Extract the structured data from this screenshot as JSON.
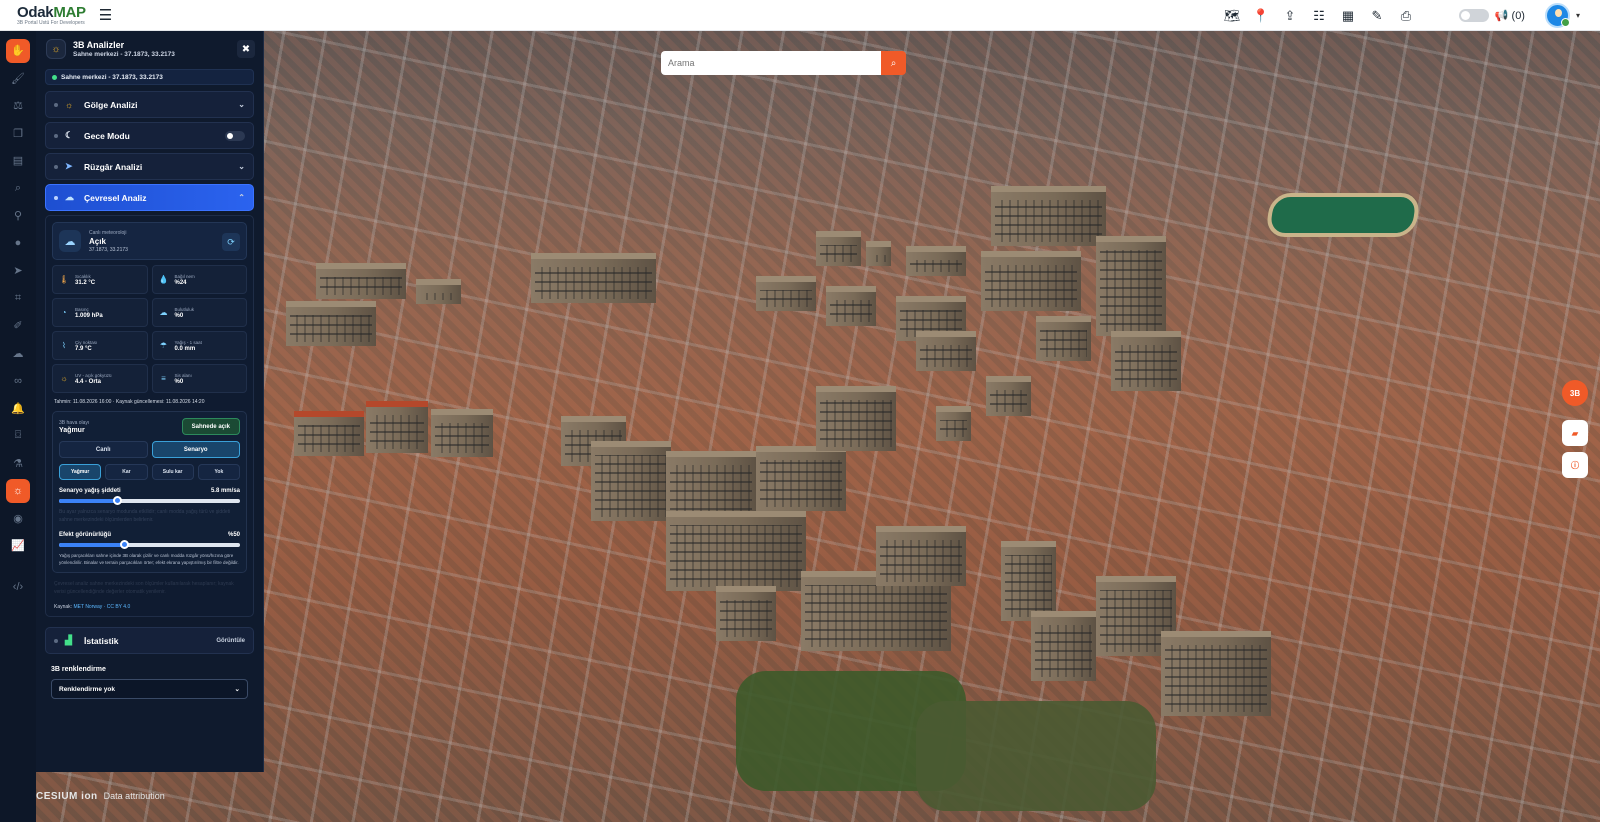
{
  "app": {
    "logo_main_a": "Odak",
    "logo_main_b": "MAP",
    "logo_sub": "3B Portal Ustü For Developers"
  },
  "header": {
    "notif_count": "(0)"
  },
  "search": {
    "placeholder": "Arama"
  },
  "map": {
    "btn_3d": "3B",
    "cesium_brand": "CESIUM ion",
    "cesium_attrib": "Data attribution"
  },
  "panel": {
    "title": "3B Analizler",
    "subtitle": "Sahne merkezi - 37.1873, 33.2173",
    "scene_strip": "Sahne merkezi - 37.1873, 33.2173",
    "sections": {
      "shadow": "Gölge Analizi",
      "night": "Gece Modu",
      "wind": "Rüzgâr Analizi",
      "env": "Çevresel Analiz",
      "stats": "İstatistik",
      "stats_side": "Görüntüle"
    },
    "current": {
      "label": "Canlı meteoroloji",
      "value": "Açık",
      "coords": "37.1873, 33.2173"
    },
    "metrics": [
      {
        "label": "Sıcaklık",
        "value": "31.2 °C",
        "icon": "thermometer-icon"
      },
      {
        "label": "Bağıl nem",
        "value": "%24",
        "icon": "droplet-icon"
      },
      {
        "label": "Basınç",
        "value": "1.009 hPa",
        "icon": "gauge-icon"
      },
      {
        "label": "Bulutluluk",
        "value": "%0",
        "icon": "cloud-icon"
      },
      {
        "label": "Çiy noktası",
        "value": "7.9 °C",
        "icon": "dew-icon"
      },
      {
        "label": "Yağış - 1 saat",
        "value": "0.0 mm",
        "icon": "umbrella-icon"
      },
      {
        "label": "UV - açık gökyüzü",
        "value": "4.4 - Orta",
        "icon": "sun-icon"
      },
      {
        "label": "Sis alanı",
        "value": "%0",
        "icon": "fog-icon"
      }
    ],
    "time_line": "Tahmin: 11.08.2026 16:00 · Kaynak güncellemesi: 11.08.2026 14:20",
    "scenario": {
      "label": "3B hava olayı",
      "value": "Yağmur",
      "open_btn": "Sahnede açık",
      "mode_live": "Canlı",
      "mode_scenario": "Senaryo",
      "types": [
        "Yağmur",
        "Kar",
        "Sulu kar",
        "Yok"
      ],
      "intensity_label": "Senaryo yağış şiddeti",
      "intensity_value": "5.8 mm/sa",
      "intensity_pct": 0.32,
      "faded_text": "Bu ayar yalnızca senaryo modunda etkilidir; canlı modda yağış türü ve şiddeti sahne merkezindeki ölçümlerden belirlenir.",
      "visibility_label": "Efekt görünürlüğü",
      "visibility_value": "%50",
      "visibility_pct": 0.36,
      "note": "Yağış parçacıkları sahne içinde 3B olarak çizilir ve canlı modda rüzgâr yönü/hızına göre yönlendirilir. Binalar ve terrain parçacıkları örter; efekt ekrana yapıştırılmış bir filtre değildir."
    },
    "faded_text2": "Çevresel analiz sahne merkezindeki son ölçümler kullanılarak hesaplanır; kaynak verisi güncellendiğinde değerler otomatik yenilenir.",
    "source_label": "Kaynak:",
    "source_value": "MET Norway · CC BY 4.0",
    "coloring": {
      "label": "3B renklendirme",
      "selected": "Renklendirme yok"
    }
  }
}
